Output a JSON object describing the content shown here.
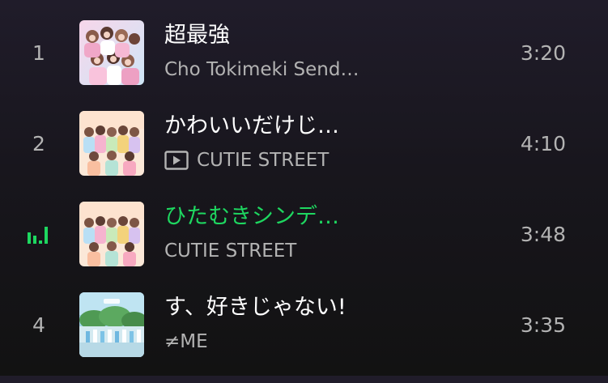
{
  "colors": {
    "accent_green": "#1ed760",
    "text_primary": "#ffffff",
    "text_secondary": "#b3b3b3"
  },
  "tracks": [
    {
      "index": "1",
      "title": "超最強",
      "artist": "Cho Tokimeki Send…",
      "duration": "3:20",
      "playing": false,
      "video_badge": false,
      "art_icon": "album-art-pink"
    },
    {
      "index": "2",
      "title": "かわいいだけじ…",
      "artist": "CUTIE STREET",
      "duration": "4:10",
      "playing": false,
      "video_badge": true,
      "video_icon": "video-icon",
      "art_icon": "album-art-peach"
    },
    {
      "index": "",
      "title": "ひたむきシンデ…",
      "artist": "CUTIE STREET",
      "duration": "3:48",
      "playing": true,
      "video_badge": false,
      "status_icon": "equalizer-icon",
      "art_icon": "album-art-peach"
    },
    {
      "index": "4",
      "title": "す、好きじゃない!",
      "artist": "≠ME",
      "duration": "3:35",
      "playing": false,
      "video_badge": false,
      "art_icon": "album-art-outdoor"
    }
  ]
}
